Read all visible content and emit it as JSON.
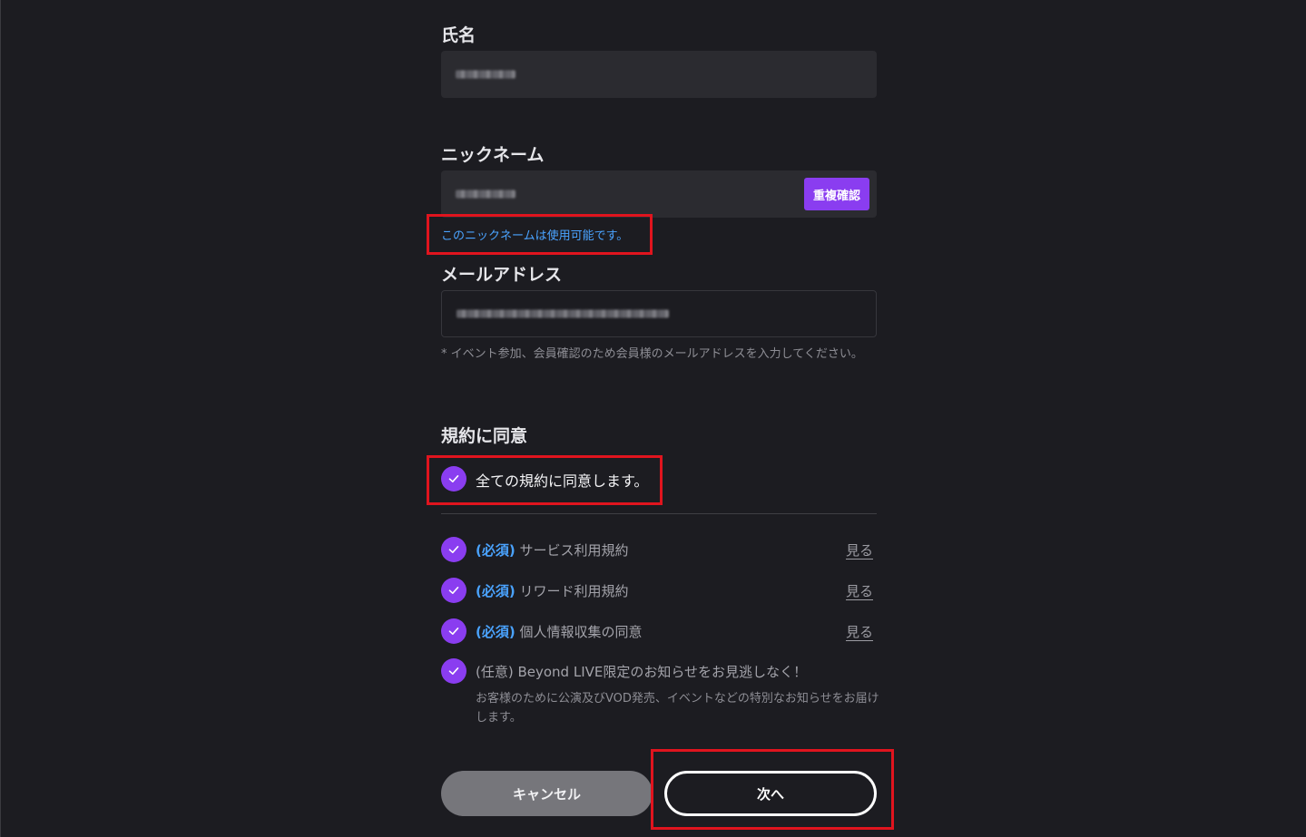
{
  "form": {
    "name": {
      "label": "氏名"
    },
    "nickname": {
      "label": "ニックネーム",
      "check_button": "重複確認",
      "available_message": "このニックネームは使用可能です。"
    },
    "email": {
      "label": "メールアドレス",
      "note": "* イベント参加、会員確認のため会員様のメールアドレスを入力してください。"
    }
  },
  "terms": {
    "heading": "規約に同意",
    "agree_all": "全ての規約に同意します。",
    "items": [
      {
        "tag": "(必須)",
        "label": "サービス利用規約",
        "link": "見る",
        "checked": true
      },
      {
        "tag": "(必須)",
        "label": "リワード利用規約",
        "link": "見る",
        "checked": true
      },
      {
        "tag": "(必須)",
        "label": "個人情報収集の同意",
        "link": "見る",
        "checked": true
      }
    ],
    "optional": {
      "label": "(任意) Beyond LIVE限定のお知らせをお見逃しなく！",
      "description": "お客様のために公演及びVOD発売、イベントなどの特別なお知らせをお届けします。",
      "checked": true
    }
  },
  "buttons": {
    "cancel": "キャンセル",
    "next": "次へ"
  },
  "colors": {
    "background": "#1c1c21",
    "accent": "#8a3df0",
    "link_blue": "#4aa3ff",
    "highlight_red": "#e0141e"
  }
}
